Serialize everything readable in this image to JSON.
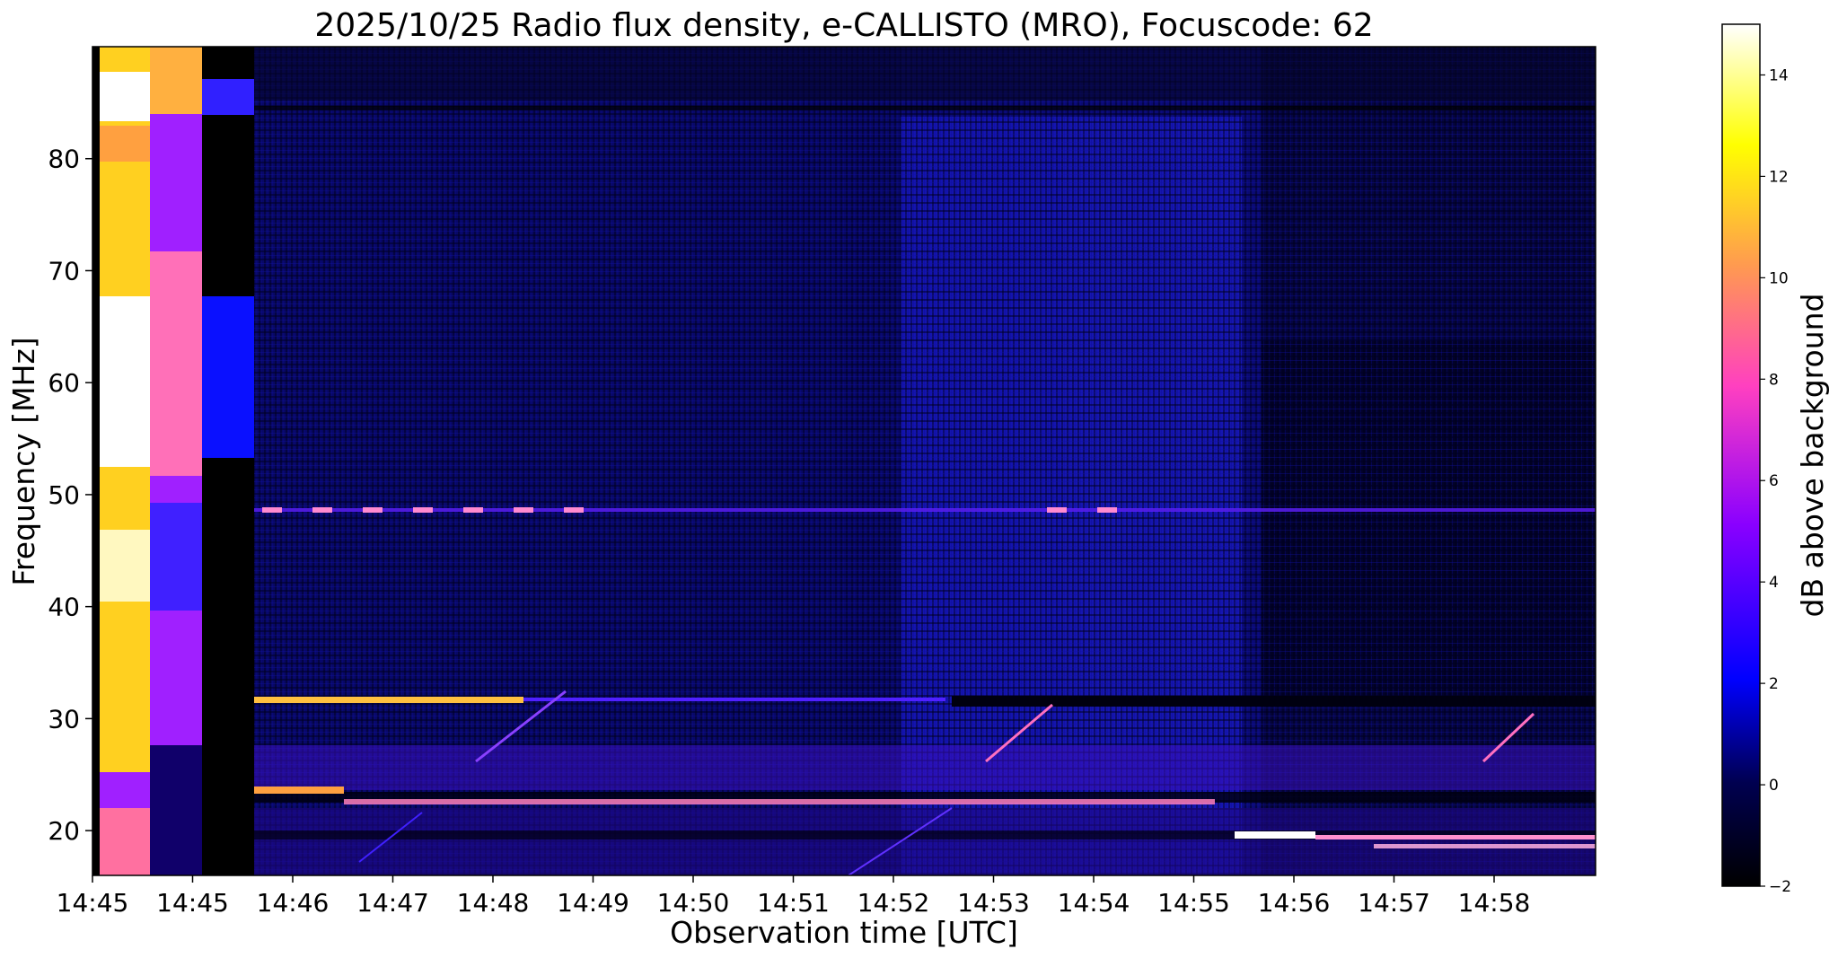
{
  "chart_data": {
    "type": "heatmap",
    "title": "2025/10/25  Radio flux density, e-CALLISTO (MRO), Focuscode: 62",
    "xlabel": "Observation time [UTC]",
    "ylabel": "Frequency [MHz]",
    "x_tick_labels": [
      "14:45",
      "14:45",
      "14:46",
      "14:47",
      "14:48",
      "14:49",
      "14:50",
      "14:51",
      "14:52",
      "14:53",
      "14:54",
      "14:55",
      "14:56",
      "14:57",
      "14:58"
    ],
    "y_ticks": [
      20,
      30,
      40,
      50,
      60,
      70,
      80
    ],
    "ylim": [
      16,
      90
    ],
    "colorbar": {
      "label": "dB above background",
      "ticks": [
        -2,
        0,
        2,
        4,
        6,
        8,
        10,
        12,
        14
      ],
      "range": [
        -2,
        15
      ],
      "colormap": "gnuplot2",
      "stops": [
        "#000000",
        "#0000ff",
        "#b000ff",
        "#ff5ab0",
        "#ffa040",
        "#ffff00",
        "#ffffff"
      ]
    },
    "features": [
      {
        "kind": "persistent-rfi-line",
        "freq_mhz": 48.5,
        "intensity_db": 9
      },
      {
        "kind": "persistent-rfi-line",
        "freq_mhz": 31.5,
        "intensity_db": 13
      },
      {
        "kind": "persistent-rfi-line",
        "freq_mhz": 22.5,
        "intensity_db": 11
      },
      {
        "kind": "persistent-rfi-line",
        "freq_mhz": 19.0,
        "intensity_db": 13
      },
      {
        "kind": "calibration-block",
        "time": "14:45",
        "intensity_db": 15
      },
      {
        "kind": "enhanced-background",
        "time_range": [
          "14:52",
          "14:54"
        ],
        "intensity_db": 2
      }
    ]
  }
}
